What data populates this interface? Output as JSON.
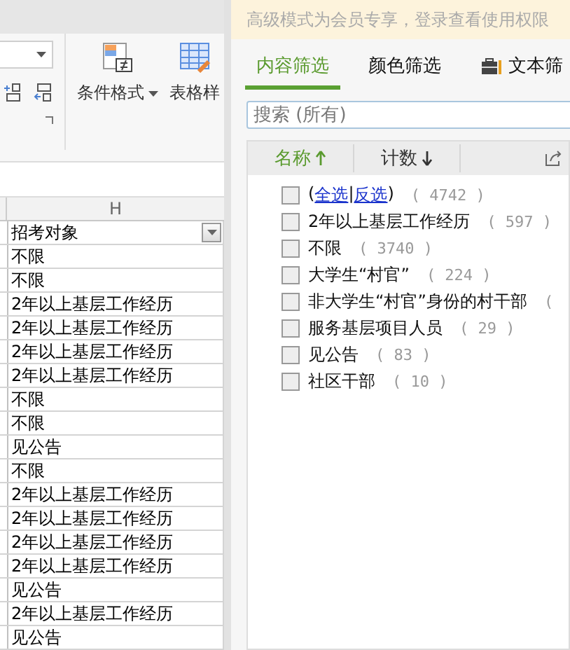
{
  "ribbon": {
    "conditional_format": "条件格式",
    "table_style": "表格样"
  },
  "sheet": {
    "column_letter": "H",
    "header": "招考对象",
    "rows": [
      "不限",
      "不限",
      "2年以上基层工作经历",
      "2年以上基层工作经历",
      "2年以上基层工作经历",
      "2年以上基层工作经历",
      "不限",
      "不限",
      "见公告",
      "不限",
      "2年以上基层工作经历",
      "2年以上基层工作经历",
      "2年以上基层工作经历",
      "2年以上基层工作经历",
      "见公告",
      "2年以上基层工作经历",
      "见公告"
    ]
  },
  "filter_panel": {
    "notice": "高级模式为会员专享，登录查看使用权限",
    "tabs": [
      {
        "label": "内容筛选",
        "selected": true
      },
      {
        "label": "颜色筛选",
        "selected": false
      },
      {
        "label": "文本筛",
        "selected": false
      }
    ],
    "search": {
      "placeholder": "搜索 (所有)"
    },
    "columns": [
      {
        "label": "名称",
        "ascending": true,
        "selected": true
      },
      {
        "label": "计数",
        "ascending": false,
        "selected": false
      }
    ],
    "items": [
      {
        "kind": "select_all",
        "open": "(",
        "select_all": "全选",
        "separator": "|",
        "invert": "反选",
        "close": ")",
        "count": "( 4742 )",
        "checked": false
      },
      {
        "kind": "value",
        "label": "2年以上基层工作经历",
        "count": "( 597 )",
        "checked": false
      },
      {
        "kind": "value",
        "label": "不限",
        "count": "( 3740 )",
        "checked": false
      },
      {
        "kind": "value",
        "label": "大学生“村官”",
        "count": "( 224 )",
        "checked": false
      },
      {
        "kind": "value",
        "label": "非大学生“村官”身份的村干部",
        "count": "(",
        "checked": false
      },
      {
        "kind": "value",
        "label": "服务基层项目人员",
        "count": "( 29 )",
        "checked": false
      },
      {
        "kind": "value",
        "label": "见公告",
        "count": "( 83 )",
        "checked": false
      },
      {
        "kind": "value",
        "label": "社区干部",
        "count": "( 10 )",
        "checked": false
      }
    ]
  }
}
